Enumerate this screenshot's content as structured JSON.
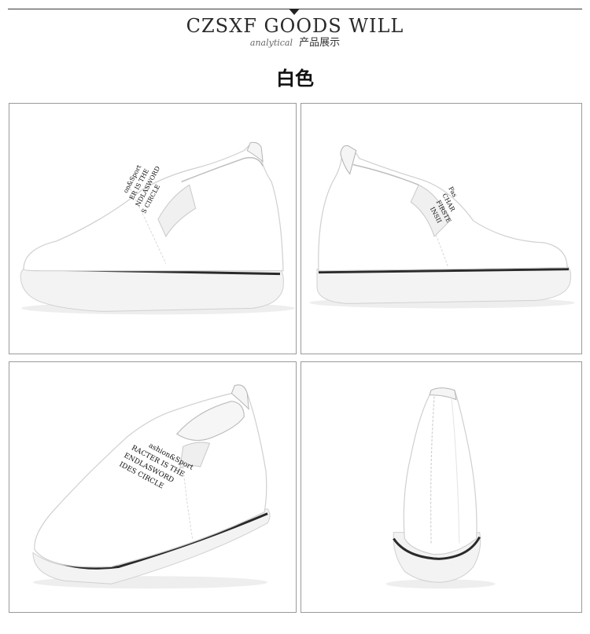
{
  "header": {
    "title": "CZSXF GOODS WILL",
    "subtitle_en": "analytical",
    "subtitle_zh": "产品展示"
  },
  "color_label": "白色",
  "photos": [
    {
      "view": "side-left",
      "print_lines": [
        "on&Sport",
        "ER IS THE",
        "NDLASWORD",
        "S CIRCLE"
      ]
    },
    {
      "view": "side-right",
      "print_lines": [
        "Fas",
        "CHAR",
        "FIRSTE",
        "INSII"
      ]
    },
    {
      "view": "three-quarter",
      "print_lines": [
        "ashion&Sport",
        "RACTER IS THE",
        "ENDLASWORD",
        "IDES CIRCLE"
      ]
    },
    {
      "view": "back",
      "print_lines": []
    }
  ]
}
